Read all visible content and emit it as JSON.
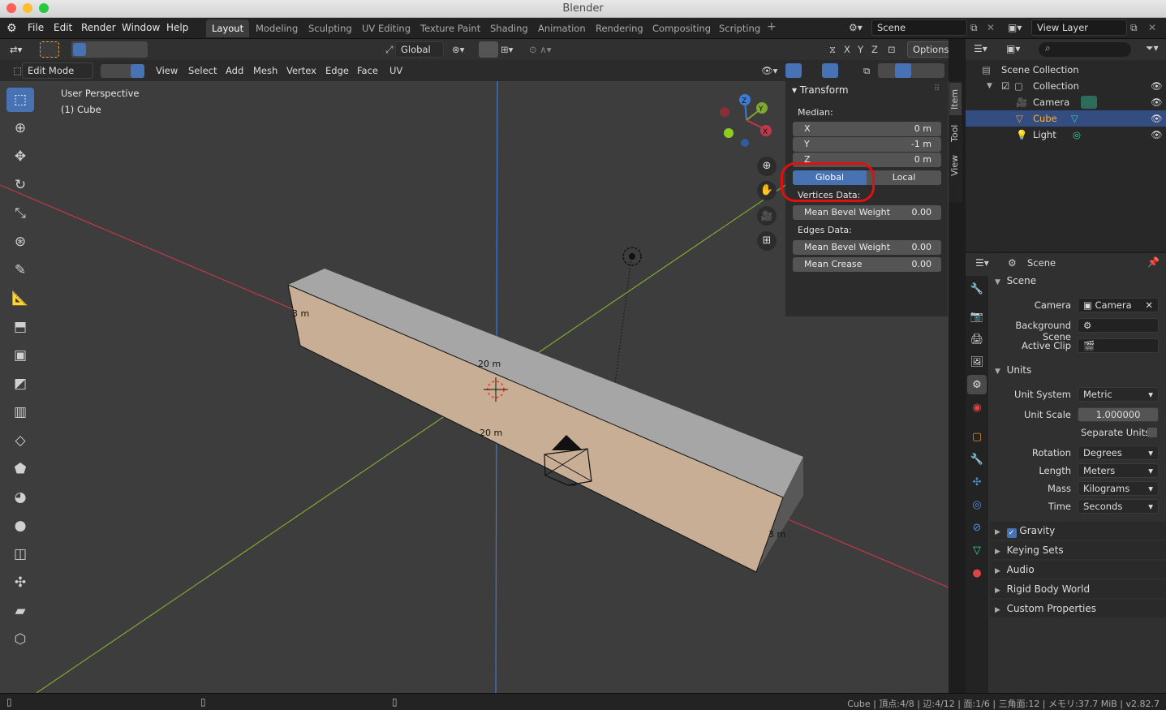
{
  "window": {
    "title": "Blender"
  },
  "menu": {
    "items": [
      "File",
      "Edit",
      "Render",
      "Window",
      "Help"
    ]
  },
  "workspaces": [
    "Layout",
    "Modeling",
    "Sculpting",
    "UV Editing",
    "Texture Paint",
    "Shading",
    "Animation",
    "Rendering",
    "Compositing",
    "Scripting"
  ],
  "scene_field": "Scene",
  "view_layer_field": "View Layer",
  "viewport": {
    "transform_orientation": "Global",
    "options_label": "Options",
    "axis_toggles": [
      "X",
      "Y",
      "Z"
    ],
    "mode": "Edit Mode",
    "header_menus": [
      "View",
      "Select",
      "Add",
      "Mesh",
      "Vertex",
      "Edge",
      "Face",
      "UV"
    ],
    "overlay_text": [
      "User Perspective",
      "(1) Cube"
    ],
    "measurements": [
      "3 m",
      "20 m",
      "20 m",
      "3 m"
    ],
    "gizmo_axes": [
      "Z",
      "Y",
      "X"
    ]
  },
  "npanel": {
    "section": "Transform",
    "median_label": "Median:",
    "coords": [
      {
        "axis": "X",
        "value": "0 m"
      },
      {
        "axis": "Y",
        "value": "-1 m"
      },
      {
        "axis": "Z",
        "value": "0 m"
      }
    ],
    "global_label": "Global",
    "local_label": "Local",
    "active_space": "Global",
    "vertices_label": "Vertices Data:",
    "vertex_fields": [
      {
        "label": "Mean Bevel Weight",
        "value": "0.00"
      }
    ],
    "edges_label": "Edges Data:",
    "edge_fields": [
      {
        "label": "Mean Bevel Weight",
        "value": "0.00"
      },
      {
        "label": "Mean Crease",
        "value": "0.00"
      }
    ],
    "tabs": [
      "Item",
      "Tool",
      "View"
    ]
  },
  "outliner": {
    "items": [
      {
        "label": "Scene Collection",
        "icon": "scene-collection-icon"
      },
      {
        "label": "Collection",
        "icon": "collection-icon"
      },
      {
        "label": "Camera",
        "icon": "camera-icon"
      },
      {
        "label": "Cube",
        "icon": "mesh-icon"
      },
      {
        "label": "Light",
        "icon": "light-icon"
      }
    ]
  },
  "properties": {
    "context": "Scene",
    "scene_section": "Scene",
    "camera_label": "Camera",
    "camera_value": "Camera",
    "background_scene_label": "Background Scene",
    "active_clip_label": "Active Clip",
    "units_section": "Units",
    "unit_system_label": "Unit System",
    "unit_system": "Metric",
    "unit_scale_label": "Unit Scale",
    "unit_scale": "1.000000",
    "separate_units_label": "Separate Units",
    "rotation_label": "Rotation",
    "rotation": "Degrees",
    "length_label": "Length",
    "length": "Meters",
    "mass_label": "Mass",
    "mass": "Kilograms",
    "time_label": "Time",
    "time": "Seconds",
    "collapsed_sections": [
      "Gravity",
      "Keying Sets",
      "Audio",
      "Rigid Body World",
      "Custom Properties"
    ],
    "gravity_checked": true
  },
  "statusbar": {
    "text": "Cube | 頂点:4/8 | 辺:4/12 | 面:1/6 | 三角面:12 | メモリ:37.7 MiB | v2.82.7"
  },
  "colors": {
    "accent": "#4772b3",
    "highlight_ring": "#e01010",
    "face_fill": "#c8ae95",
    "face_top": "#a6a6a6",
    "x_axis": "#c0394a",
    "y_axis": "#7fa832",
    "z_axis": "#3d7bd6"
  }
}
